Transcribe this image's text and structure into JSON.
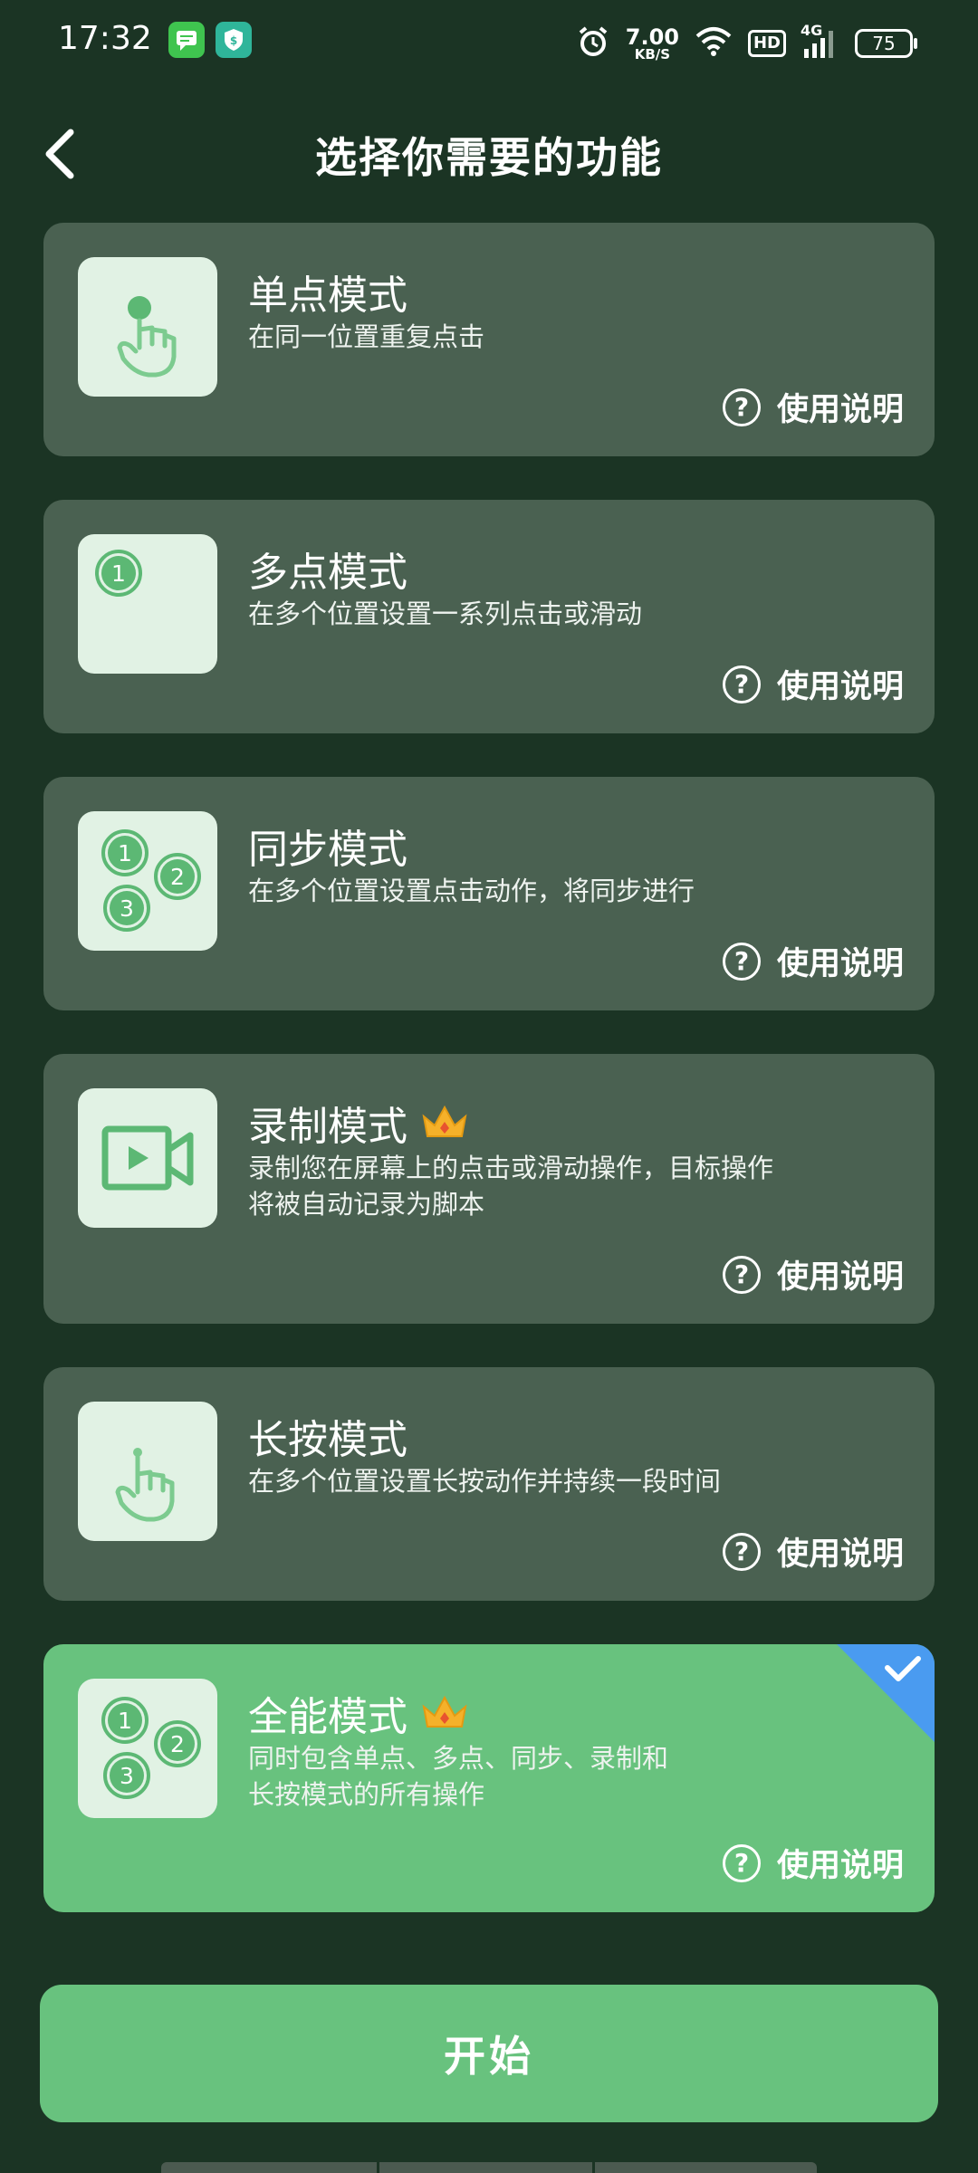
{
  "status_bar": {
    "time": "17:32",
    "net_speed_value": "7.00",
    "net_speed_unit": "KB/S",
    "hd": "HD",
    "network": "4G",
    "battery": "75",
    "icons": [
      "message-icon",
      "security-shield-icon",
      "alarm-icon",
      "wifi-icon",
      "signal-icon",
      "battery-icon"
    ]
  },
  "header": {
    "title": "选择你需要的功能",
    "back_icon": "chevron-left-icon"
  },
  "modes": [
    {
      "title": "单点模式",
      "desc": "在同一位置重复点击",
      "help": "使用说明",
      "premium": false,
      "selected": false,
      "icon": "single-tap-hand-icon"
    },
    {
      "title": "多点模式",
      "desc": "在多个位置设置一系列点击或滑动",
      "help": "使用说明",
      "premium": false,
      "selected": false,
      "icon": "multi-point-icon",
      "icon_numbers": [
        "1"
      ]
    },
    {
      "title": "同步模式",
      "desc": "在多个位置设置点击动作，将同步进行",
      "help": "使用说明",
      "premium": false,
      "selected": false,
      "icon": "sync-points-icon",
      "icon_numbers": [
        "1",
        "2",
        "3"
      ]
    },
    {
      "title": "录制模式",
      "desc_lines": [
        "录制您在屏幕上的点击或滑动操作，目标操作",
        "将被自动记录为脚本"
      ],
      "help": "使用说明",
      "premium": true,
      "selected": false,
      "icon": "video-record-icon"
    },
    {
      "title": "长按模式",
      "desc": "在多个位置设置长按动作并持续一段时间",
      "help": "使用说明",
      "premium": false,
      "selected": false,
      "icon": "long-press-hand-icon"
    },
    {
      "title": "全能模式",
      "desc_lines": [
        "同时包含单点、多点、同步、录制和",
        "长按模式的所有操作"
      ],
      "help": "使用说明",
      "premium": true,
      "selected": true,
      "icon": "all-modes-icon",
      "icon_numbers": [
        "1",
        "2",
        "3"
      ]
    }
  ],
  "start_button": {
    "label": "开始"
  },
  "colors": {
    "background": "#1b3424",
    "card": "#4a6151",
    "card_selected": "#68c27e",
    "icon_bg": "#e1f2e4",
    "accent_green": "#5cb874",
    "check_blue": "#4a9bf0",
    "crown": "#f5b12a"
  }
}
